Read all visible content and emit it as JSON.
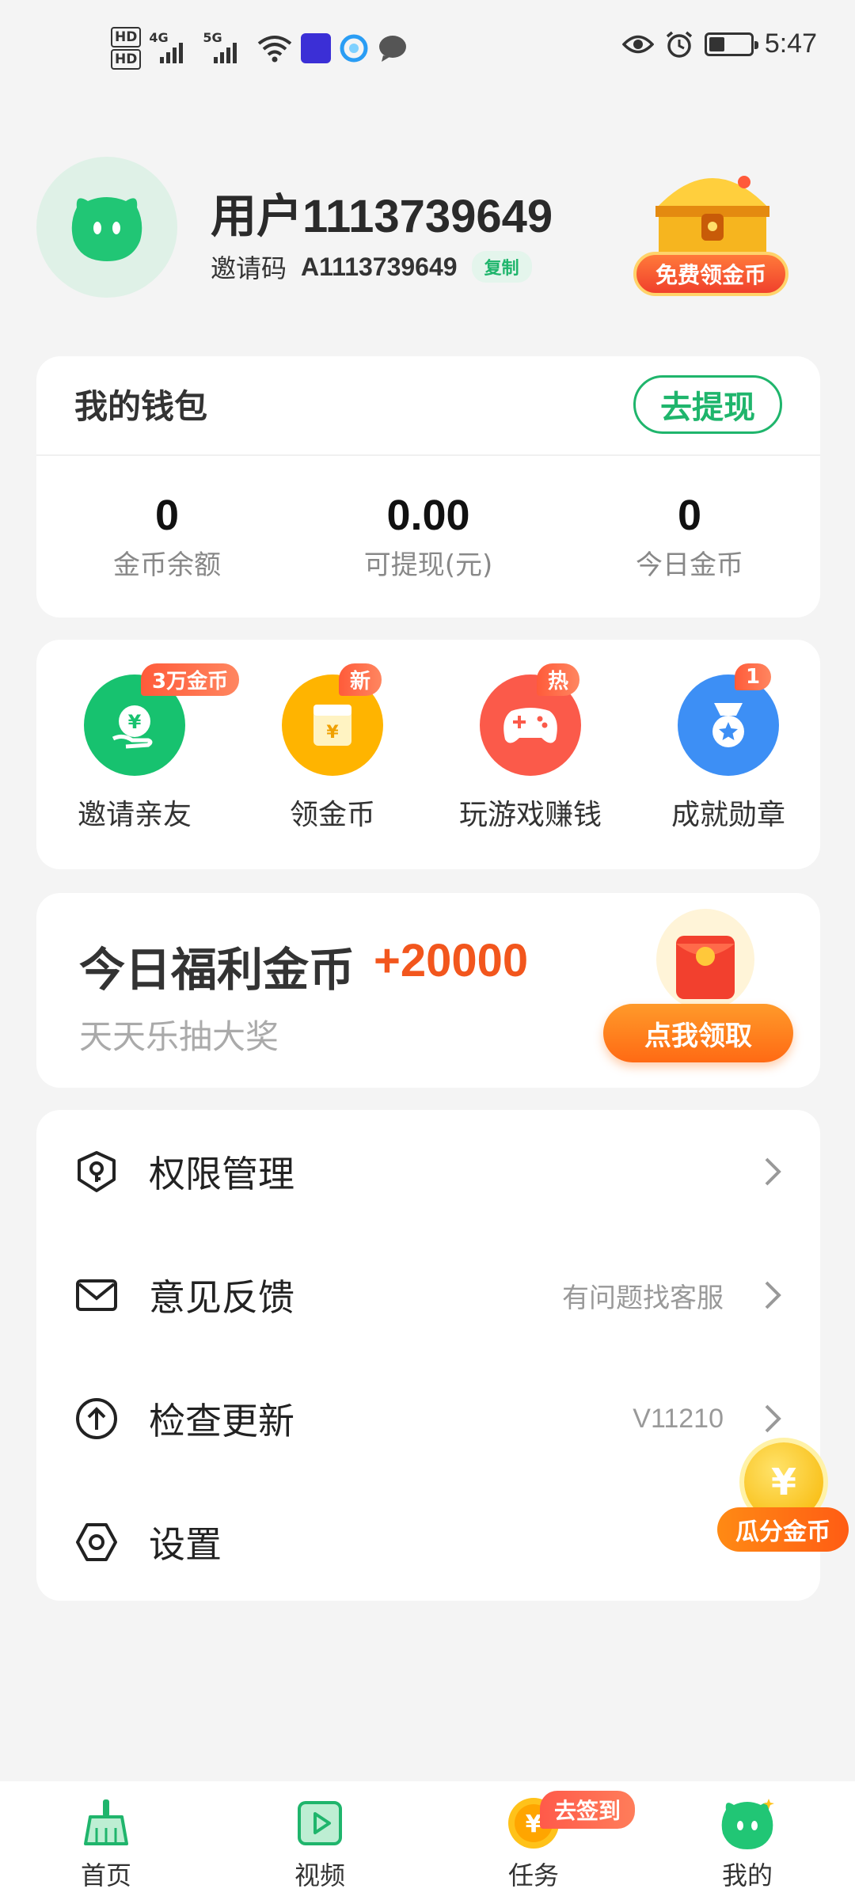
{
  "status_bar": {
    "time": "5:47",
    "network_labels": [
      "4G",
      "5G"
    ],
    "hd_labels": [
      "HD",
      "HD"
    ],
    "icons": [
      "hd-icon",
      "signal-4g-icon",
      "signal-5g-icon",
      "wifi-icon",
      "app-notification-icon",
      "qq-browser-icon",
      "message-icon",
      "eye-icon",
      "alarm-icon",
      "battery-icon"
    ],
    "battery_level": 0.35
  },
  "profile": {
    "username": "用户1113739649",
    "invite_label": "邀请码",
    "invite_code": "A1113739649",
    "copy_label": "复制",
    "treasure_label": "免费领金币"
  },
  "wallet": {
    "title": "我的钱包",
    "withdraw_label": "去提现",
    "stats": [
      {
        "value": "0",
        "label": "金币余额"
      },
      {
        "value": "0.00",
        "label": "可提现(元)"
      },
      {
        "value": "0",
        "label": "今日金币"
      }
    ]
  },
  "quick_actions": [
    {
      "label": "邀请亲友",
      "badge": "3万金币",
      "icon": "invite-money-icon",
      "color": "#17c26f"
    },
    {
      "label": "领金币",
      "badge": "新",
      "icon": "coin-box-icon",
      "color": "#ffb400"
    },
    {
      "label": "玩游戏赚钱",
      "badge": "热",
      "icon": "gamepad-icon",
      "color": "#fb5a4a"
    },
    {
      "label": "成就勋章",
      "badge": "1",
      "icon": "medal-icon",
      "color": "#3d8ff5"
    }
  ],
  "welfare": {
    "title": "今日福利金币",
    "amount": "+20000",
    "subtitle": "天天乐抽大奖",
    "button_label": "点我领取"
  },
  "menu": [
    {
      "label": "权限管理",
      "hint": "",
      "icon": "shield-key-icon"
    },
    {
      "label": "意见反馈",
      "hint": "有问题找客服",
      "icon": "mail-icon"
    },
    {
      "label": "检查更新",
      "hint": "V11210",
      "icon": "upload-arrow-icon"
    },
    {
      "label": "设置",
      "hint": "",
      "icon": "hexagon-settings-icon"
    }
  ],
  "floating": {
    "coin_symbol": "¥",
    "label": "瓜分金币"
  },
  "bottom_nav": {
    "items": [
      {
        "label": "首页",
        "icon": "broom-icon"
      },
      {
        "label": "视频",
        "icon": "video-play-icon"
      },
      {
        "label": "任务",
        "icon": "coin-task-icon"
      },
      {
        "label": "我的",
        "icon": "mascot-icon"
      }
    ],
    "task_badge": "去签到"
  },
  "colors": {
    "brand_green": "#1fb56c",
    "accent_orange": "#ff6a14",
    "amount_red": "#f2561d"
  }
}
